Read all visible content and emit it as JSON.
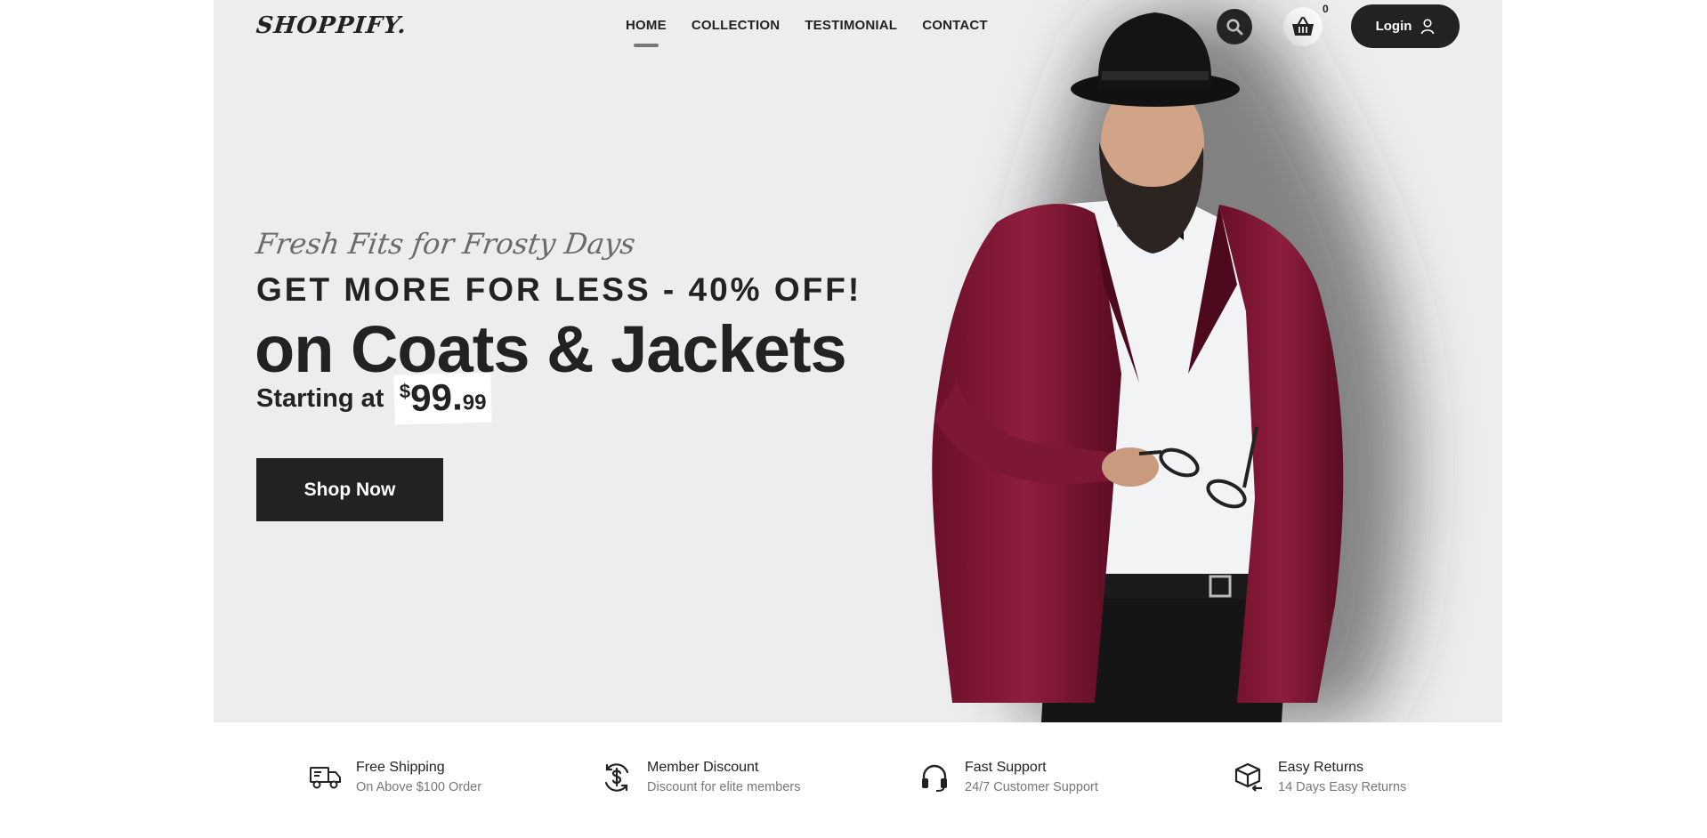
{
  "brand": {
    "logo": "SHOPPIFY."
  },
  "nav": {
    "items": [
      {
        "label": "HOME",
        "active": true
      },
      {
        "label": "COLLECTION",
        "active": false
      },
      {
        "label": "TESTIMONIAL",
        "active": false
      },
      {
        "label": "CONTACT",
        "active": false
      }
    ]
  },
  "header": {
    "search_icon": "search-icon",
    "cart_icon": "basket-icon",
    "cart_count": "0",
    "login_label": "Login",
    "login_icon": "user-icon"
  },
  "hero": {
    "tagline": "Fresh Fits for Frosty Days",
    "headline_1": "GET MORE FOR LESS - 40% OFF!",
    "headline_2": "on Coats & Jackets",
    "starting_label": "Starting at",
    "price_currency": "$",
    "price_whole": "99.",
    "price_cents": "99",
    "cta_label": "Shop Now"
  },
  "features": [
    {
      "icon": "truck-icon",
      "title": "Free Shipping",
      "subtitle": "On Above $100 Order"
    },
    {
      "icon": "dollar-cycle-icon",
      "title": "Member Discount",
      "subtitle": "Discount for elite members"
    },
    {
      "icon": "headset-icon",
      "title": "Fast Support",
      "subtitle": "24/7 Customer Support"
    },
    {
      "icon": "box-return-icon",
      "title": "Easy Returns",
      "subtitle": "14 Days Easy Returns"
    }
  ],
  "colors": {
    "hero_bg": "#ededef",
    "dark": "#222222",
    "jacket": "#7a1530",
    "muted": "#777777"
  }
}
